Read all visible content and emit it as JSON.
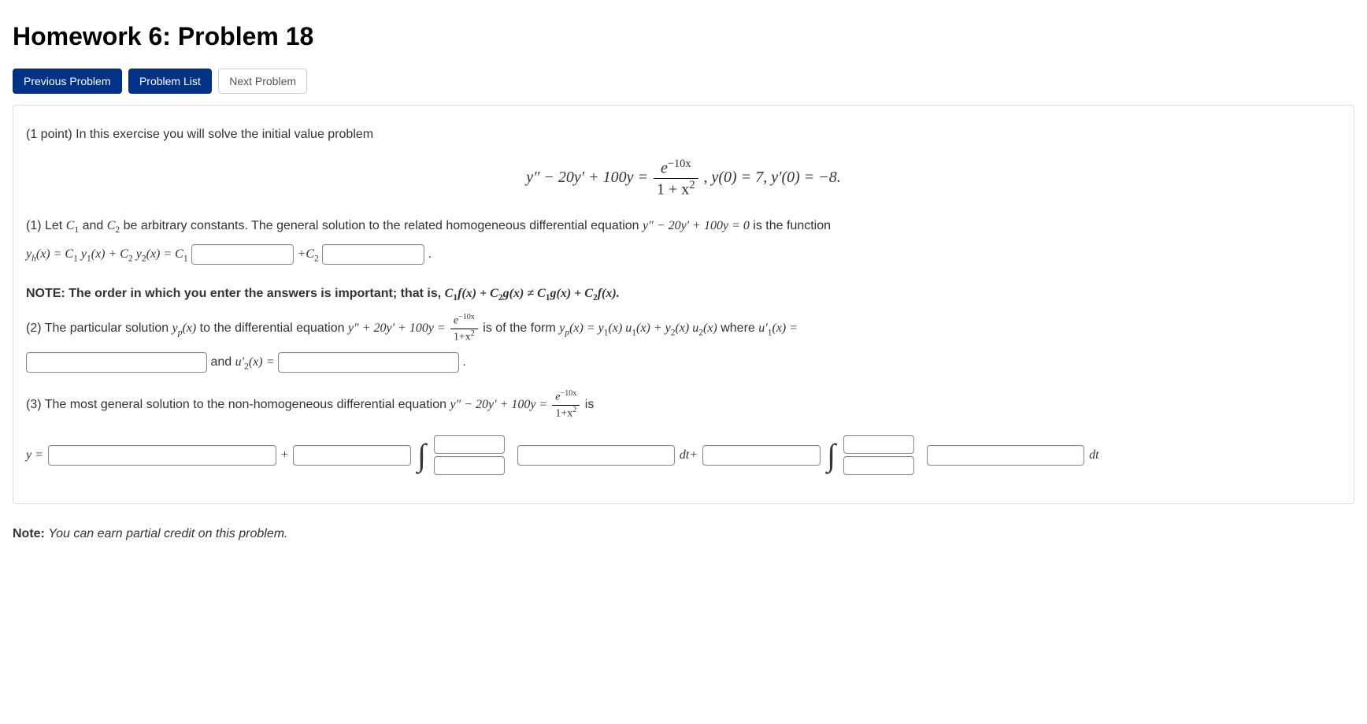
{
  "title": "Homework 6: Problem 18",
  "nav": {
    "prev": "Previous Problem",
    "list": "Problem List",
    "next": "Next Problem"
  },
  "intro_points": "(1 point) ",
  "intro_text": "In this exercise you will solve the initial value problem",
  "main_eq": {
    "lhs": "y″ − 20y′ + 100y = ",
    "num": "e",
    "num_exp": "−10x",
    "den_pre": "1 + x",
    "den_exp": "2",
    "comma": " ,",
    "ic1": "   y(0) = 7,   y′(0) = −8."
  },
  "p1": {
    "pre": "(1) Let ",
    "c1": "C",
    "c1s": "1",
    "and": " and ",
    "c2": "C",
    "c2s": "2",
    "mid": " be arbitrary constants. The general solution to the related homogeneous differential equation ",
    "ode": "y″ − 20y′ + 100y = 0",
    "post": " is the function",
    "line2a": "y",
    "line2a_sub": "h",
    "line2a2": "(x) = C",
    "s1": "1",
    "y1": " y",
    "y1s": "1",
    "xp": "(x) + C",
    "s2": "2",
    "y2": " y",
    "y2s": "2",
    "xp2": "(x) = C",
    "eqC1": "1",
    "plusC2": "+C",
    "plusC2s": "2",
    "dot": " ."
  },
  "note1": {
    "pre": "NOTE: The order in which you enter the answers is important; that is, ",
    "math": "C₁f(x) + C₂g(x) ≠ C₁g(x) + C₂f(x).",
    "m_c": "C",
    "m_1": "1",
    "m_f": "f(x) + C",
    "m_2": "2",
    "m_g": "g(x) ≠ C",
    "m_g2": "g(x) + C",
    "m_f2": "f(x)."
  },
  "p2": {
    "pre": "(2) The particular solution ",
    "yp": "y",
    "yps": "p",
    "ypx": "(x)",
    "mid": " to the differential equation ",
    "ode": "y″ + 20y′ + 100y = ",
    "num": "e",
    "numexp": "−10x",
    "den": "1+x",
    "dene": "2",
    "isof": " is of the form ",
    "form": "y",
    "formps": "p",
    "formx": "(x) = y",
    "f1": "1",
    "fx": "(x) u",
    "u1": "1",
    "fx2": "(x) + y",
    "f2": "2",
    "fx3": "(x) u",
    "u2": "2",
    "fx4": "(x)",
    "where": " where ",
    "u1p": "u′",
    "u1ps": "1",
    "u1px": "(x) =",
    "and": " and ",
    "u2p": "u′",
    "u2ps": "2",
    "u2px": "(x) =",
    "dot": " ."
  },
  "p3": {
    "pre": "(3) The most general solution to the non-homogeneous differential equation ",
    "ode": "y″ − 20y′ + 100y = ",
    "num": "e",
    "numexp": "−10x",
    "den": "1+x",
    "dene": "2",
    "is": " is"
  },
  "gen": {
    "yeq": "y = ",
    "plus": " + ",
    "dtplus": " dt+ ",
    "dt": " dt"
  },
  "note2": {
    "pre": "Note: ",
    "txt": "You can earn partial credit on this problem."
  }
}
